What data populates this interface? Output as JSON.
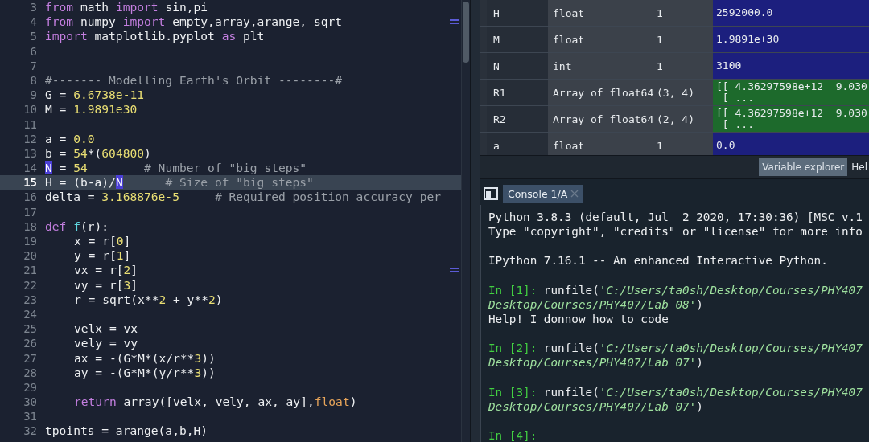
{
  "editor": {
    "lines": [
      {
        "number": "3",
        "current": false,
        "marked": false,
        "segments": [
          {
            "kind": "kw",
            "text": "from"
          },
          {
            "kind": "plain",
            "text": " math "
          },
          {
            "kind": "kw",
            "text": "import"
          },
          {
            "kind": "plain",
            "text": " sin,pi"
          }
        ]
      },
      {
        "number": "4",
        "current": false,
        "marked": true,
        "segments": [
          {
            "kind": "kw",
            "text": "from"
          },
          {
            "kind": "plain",
            "text": " numpy "
          },
          {
            "kind": "kw",
            "text": "import"
          },
          {
            "kind": "plain",
            "text": " empty,array,arange, sqrt"
          }
        ]
      },
      {
        "number": "5",
        "current": false,
        "marked": false,
        "segments": [
          {
            "kind": "kw",
            "text": "import"
          },
          {
            "kind": "plain",
            "text": " matplotlib.pyplot "
          },
          {
            "kind": "kw",
            "text": "as"
          },
          {
            "kind": "plain",
            "text": " plt"
          }
        ]
      },
      {
        "number": "6",
        "current": false,
        "marked": false
      },
      {
        "number": "7",
        "current": false,
        "marked": false
      },
      {
        "number": "8",
        "current": false,
        "marked": false,
        "segments": [
          {
            "kind": "comment",
            "text": "#------- Modelling Earth's Orbit --------#"
          }
        ]
      },
      {
        "number": "9",
        "current": false,
        "marked": false,
        "segments": [
          {
            "kind": "plain",
            "text": "G = "
          },
          {
            "kind": "num",
            "text": "6.6738e-11"
          }
        ]
      },
      {
        "number": "10",
        "current": false,
        "marked": false,
        "segments": [
          {
            "kind": "plain",
            "text": "M = "
          },
          {
            "kind": "num",
            "text": "1.9891e30"
          }
        ]
      },
      {
        "number": "11",
        "current": false,
        "marked": false
      },
      {
        "number": "12",
        "current": false,
        "marked": false,
        "segments": [
          {
            "kind": "plain",
            "text": "a = "
          },
          {
            "kind": "num",
            "text": "0.0"
          }
        ]
      },
      {
        "number": "13",
        "current": false,
        "marked": false,
        "segments": [
          {
            "kind": "plain",
            "text": "b = "
          },
          {
            "kind": "num",
            "text": "54"
          },
          {
            "kind": "plain",
            "text": "*("
          },
          {
            "kind": "num",
            "text": "604800"
          },
          {
            "kind": "plain",
            "text": ")"
          }
        ]
      },
      {
        "number": "14",
        "current": false,
        "marked": false,
        "segments": [
          {
            "kind": "match",
            "text": "N"
          },
          {
            "kind": "plain",
            "text": " = "
          },
          {
            "kind": "num",
            "text": "54        "
          },
          {
            "kind": "comment",
            "text": "# Number of \"big steps\""
          }
        ]
      },
      {
        "number": "15",
        "current": true,
        "marked": false,
        "segments": [
          {
            "kind": "plain",
            "text": "H = (b-a)/"
          },
          {
            "kind": "match",
            "text": "N"
          },
          {
            "kind": "comment",
            "text": "      # Size of \"big steps\""
          }
        ]
      },
      {
        "number": "16",
        "current": false,
        "marked": false,
        "segments": [
          {
            "kind": "plain",
            "text": "delta = "
          },
          {
            "kind": "num",
            "text": "3.168876e-5     "
          },
          {
            "kind": "comment",
            "text": "# Required position accuracy per"
          }
        ]
      },
      {
        "number": "17",
        "current": false,
        "marked": false
      },
      {
        "number": "18",
        "current": false,
        "marked": false,
        "segments": [
          {
            "kind": "kw",
            "text": "def "
          },
          {
            "kind": "fn",
            "text": "f"
          },
          {
            "kind": "plain",
            "text": "(r):"
          }
        ],
        "children": [
          {
            "number": "19",
            "current": false,
            "marked": false,
            "segments": [
              {
                "kind": "plain",
                "text": "x = r["
              },
              {
                "kind": "num",
                "text": "0"
              },
              {
                "kind": "plain",
                "text": "]"
              }
            ]
          },
          {
            "number": "20",
            "current": false,
            "marked": false,
            "segments": [
              {
                "kind": "plain",
                "text": "y = r["
              },
              {
                "kind": "num",
                "text": "1"
              },
              {
                "kind": "plain",
                "text": "]"
              }
            ]
          },
          {
            "number": "21",
            "current": false,
            "marked": true,
            "segments": [
              {
                "kind": "plain",
                "text": "vx = r["
              },
              {
                "kind": "num",
                "text": "2"
              },
              {
                "kind": "plain",
                "text": "]"
              }
            ]
          },
          {
            "number": "22",
            "current": false,
            "marked": false,
            "segments": [
              {
                "kind": "plain",
                "text": "vy = r["
              },
              {
                "kind": "num",
                "text": "3"
              },
              {
                "kind": "plain",
                "text": "]"
              }
            ]
          },
          {
            "number": "23",
            "current": false,
            "marked": false,
            "segments": [
              {
                "kind": "plain",
                "text": "r = sqrt(x**"
              },
              {
                "kind": "num",
                "text": "2"
              },
              {
                "kind": "plain",
                "text": " + y**"
              },
              {
                "kind": "num",
                "text": "2"
              },
              {
                "kind": "plain",
                "text": ")"
              }
            ]
          },
          {
            "number": "24",
            "current": false,
            "marked": false
          },
          {
            "number": "25",
            "current": false,
            "marked": false,
            "segments": [
              {
                "kind": "plain",
                "text": "velx = vx"
              }
            ]
          },
          {
            "number": "26",
            "current": false,
            "marked": false,
            "segments": [
              {
                "kind": "plain",
                "text": "vely = vy"
              }
            ]
          },
          {
            "number": "27",
            "current": false,
            "marked": false,
            "segments": [
              {
                "kind": "plain",
                "text": "ax = -(G*M*(x/r**"
              },
              {
                "kind": "num",
                "text": "3"
              },
              {
                "kind": "plain",
                "text": "))"
              }
            ]
          },
          {
            "number": "28",
            "current": false,
            "marked": false,
            "segments": [
              {
                "kind": "plain",
                "text": "ay = -(G*M*(y/r**"
              },
              {
                "kind": "num",
                "text": "3"
              },
              {
                "kind": "plain",
                "text": "))"
              }
            ]
          },
          {
            "number": "29",
            "current": false,
            "marked": false
          },
          {
            "number": "30",
            "current": false,
            "marked": false,
            "segments": [
              {
                "kind": "kw",
                "text": "return"
              },
              {
                "kind": "plain",
                "text": " array([velx, vely, ax, ay],"
              },
              {
                "kind": "builtin",
                "text": "float"
              },
              {
                "kind": "plain",
                "text": ")"
              }
            ]
          }
        ]
      },
      {
        "number": "31",
        "current": false,
        "marked": false
      },
      {
        "number": "32",
        "current": false,
        "marked": false,
        "segments": [
          {
            "kind": "plain",
            "text": "tpoints = arange(a,b,H)"
          }
        ]
      }
    ]
  },
  "variables": {
    "rows": [
      {
        "name": "H",
        "type": "float",
        "size": "1",
        "value": [
          "2592000.0"
        ],
        "color": "#1c1f7e"
      },
      {
        "name": "M",
        "type": "float",
        "size": "1",
        "value": [
          "1.9891e+30"
        ],
        "color": "#1c1f7e"
      },
      {
        "name": "N",
        "type": "int",
        "size": "1",
        "value": [
          "3100"
        ],
        "color": "#1c1f7e"
      },
      {
        "name": "R1",
        "type": "Array of float64",
        "size": "(3, 4)",
        "value": [
          "[[ 4.36297598e+12  9.030",
          " [ ..."
        ],
        "color": "#1d6a2c"
      },
      {
        "name": "R2",
        "type": "Array of float64",
        "size": "(2, 4)",
        "value": [
          "[[ 4.36297598e+12  9.030",
          " [ ..."
        ],
        "color": "#1d6a2c"
      },
      {
        "name": "a",
        "type": "float",
        "size": "1",
        "value": [
          "0.0"
        ],
        "color": "#1c1f7e"
      }
    ]
  },
  "pane_tabs": [
    {
      "label": "Variable explorer",
      "selected": true
    },
    {
      "label": "Hel",
      "selected": false
    }
  ],
  "console_tabs": [
    {
      "label": "Console 1/A",
      "selected": true
    }
  ],
  "console": {
    "blocks": [
      [
        {
          "segments": [
            {
              "kind": "plain",
              "text": "Python 3.8.3 (default, Jul  2 2020, 17:30:36) [MSC v.1"
            }
          ]
        },
        {
          "segments": [
            {
              "kind": "plain",
              "text": "Type \"copyright\", \"credits\" or \"license\" for more info"
            }
          ]
        }
      ],
      [
        {
          "segments": [
            {
              "kind": "plain",
              "text": "IPython 7.16.1 -- An enhanced Interactive Python."
            }
          ]
        }
      ],
      [
        {
          "segments": [
            {
              "kind": "prompt",
              "text": "In [1]:"
            },
            {
              "kind": "plain",
              "text": " runfile("
            },
            {
              "kind": "string",
              "text": "'C:/Users/ta0sh/Desktop/Courses/PHY407"
            }
          ]
        },
        {
          "segments": [
            {
              "kind": "string",
              "text": "Desktop/Courses/PHY407/Lab 08'"
            },
            {
              "kind": "plain",
              "text": ")"
            }
          ]
        },
        {
          "segments": [
            {
              "kind": "plain",
              "text": "Help! I donnow how to code"
            }
          ]
        }
      ],
      [
        {
          "segments": [
            {
              "kind": "prompt",
              "text": "In [2]:"
            },
            {
              "kind": "plain",
              "text": " runfile("
            },
            {
              "kind": "string",
              "text": "'C:/Users/ta0sh/Desktop/Courses/PHY407"
            }
          ]
        },
        {
          "segments": [
            {
              "kind": "string",
              "text": "Desktop/Courses/PHY407/Lab 07'"
            },
            {
              "kind": "plain",
              "text": ")"
            }
          ]
        }
      ],
      [
        {
          "segments": [
            {
              "kind": "prompt",
              "text": "In [3]:"
            },
            {
              "kind": "plain",
              "text": " runfile("
            },
            {
              "kind": "string",
              "text": "'C:/Users/ta0sh/Desktop/Courses/PHY407"
            }
          ]
        },
        {
          "segments": [
            {
              "kind": "string",
              "text": "Desktop/Courses/PHY407/Lab 07'"
            },
            {
              "kind": "plain",
              "text": ")"
            }
          ]
        }
      ],
      [
        {
          "segments": [
            {
              "kind": "prompt",
              "text": "In [4]:"
            }
          ]
        }
      ]
    ]
  }
}
